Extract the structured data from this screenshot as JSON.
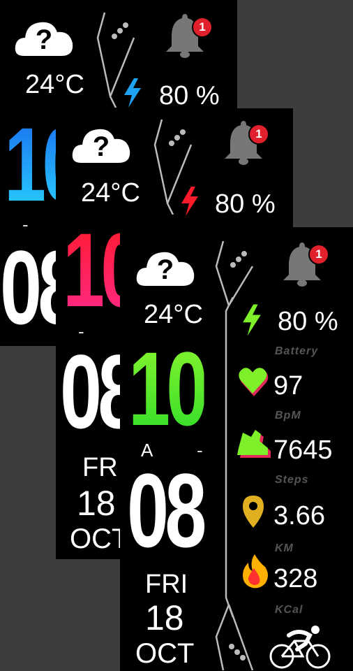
{
  "colors": {
    "background": "#3d3d3d",
    "screen": "#000000",
    "accent_blue": "#1fa3f0",
    "accent_red": "#ff1a55",
    "accent_green": "#7df02a",
    "badge": "#e0202a",
    "label_gray": "#555555"
  },
  "icons": [
    "weather-unknown-cloud-icon",
    "bell-icon",
    "lightning-icon",
    "heart-icon",
    "shoe-icon",
    "location-pin-icon",
    "flame-icon",
    "cyclist-icon"
  ],
  "weather": {
    "temp": "24°C"
  },
  "notifications": {
    "count": "1"
  },
  "battery": {
    "value": "80 %",
    "label": "Battery"
  },
  "time": {
    "hour": "10",
    "minute": "08",
    "ampm": "A",
    "separator": "-"
  },
  "date": {
    "day": "FRI",
    "date": "18",
    "month": "OCT"
  },
  "metrics": {
    "heart": {
      "value": "97",
      "label": "BpM"
    },
    "steps": {
      "value": "7645",
      "label": "Steps"
    },
    "distance": {
      "value": "3.66",
      "label": "KM"
    },
    "calories": {
      "value": "328",
      "label": "KCal"
    }
  }
}
